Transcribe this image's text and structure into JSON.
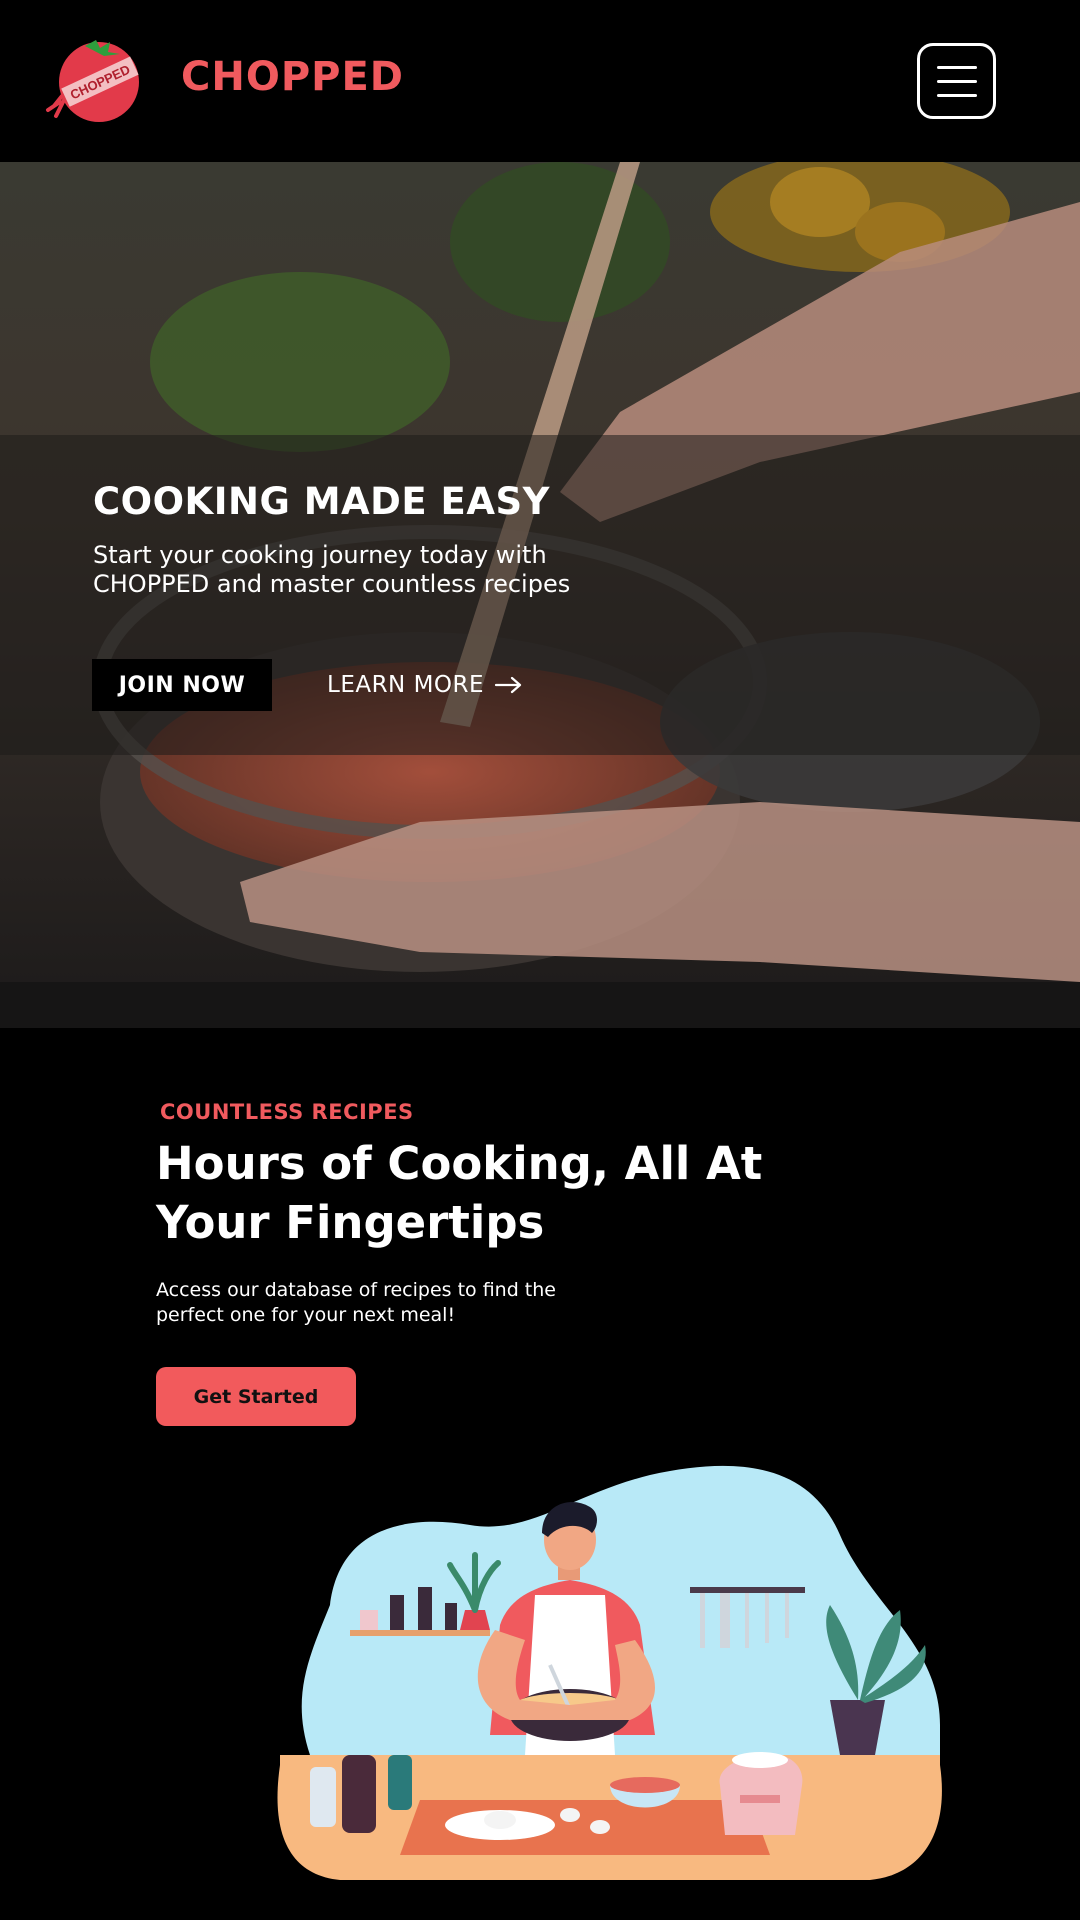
{
  "header": {
    "brand": "CHOPPED",
    "logo_text": "CHOPPED",
    "menu_icon": "hamburger-menu-icon"
  },
  "hero": {
    "title": "COOKING MADE EASY",
    "subtitle": "Start your cooking journey today with CHOPPED and master countless recipes",
    "join_label": "JOIN NOW",
    "learn_label": "LEARN MORE",
    "learn_icon": "arrow-right-icon"
  },
  "recipes": {
    "eyebrow": "COUNTLESS RECIPES",
    "headline": "Hours of Cooking, All At Your Fingertips",
    "description": "Access our database of recipes to find the perfect one for your next meal!",
    "cta_label": "Get Started"
  },
  "colors": {
    "accent": "#f05a5e",
    "background": "#000000",
    "cta": "#f25a5c"
  }
}
